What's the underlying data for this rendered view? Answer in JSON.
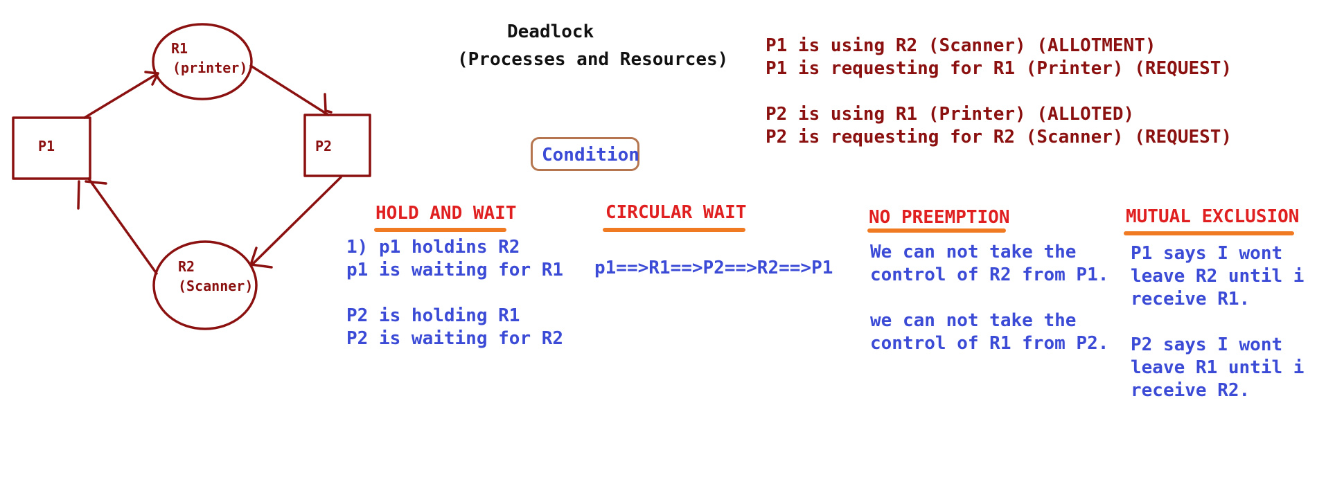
{
  "title": "Deadlock",
  "subtitle": "(Processes and Resources)",
  "allocation_text": "P1 is using R2 (Scanner) (ALLOTMENT)\nP1 is requesting for R1 (Printer) (REQUEST)\n\nP2 is using R1 (Printer) (ALLOTED)\nP2 is requesting for R2 (Scanner) (REQUEST)",
  "condition_label": "Condition",
  "graph": {
    "p1": "P1",
    "p2": "P2",
    "r1_name": "R1",
    "r1_type": "(printer)",
    "r2_name": "R2",
    "r2_type": "(Scanner)"
  },
  "conditions": {
    "hold_and_wait": {
      "heading": "HOLD AND WAIT",
      "text": "1) p1 holdins R2\np1 is waiting for R1\n\nP2 is holding R1\nP2 is waiting for R2"
    },
    "circular_wait": {
      "heading": "CIRCULAR WAIT",
      "text": "p1==>R1==>P2==>R2==>P1"
    },
    "no_preemption": {
      "heading": "NO PREEMPTION",
      "text": "We can not take the\ncontrol of R2 from P1.\n\nwe can not take the\ncontrol of R1 from P2."
    },
    "mutual_exclusion": {
      "heading": "MUTUAL EXCLUSION",
      "text": "P1 says I wont\nleave R2 until i\nreceive R1.\n\nP2 says I wont\nleave R1 until i\nreceive R2."
    }
  },
  "colors": {
    "ink_dark": "#111111",
    "graph_maroon": "#8b1010",
    "body_blue": "#3b4bd6",
    "heading_red": "#e02020",
    "underline_orange": "#f07a22",
    "condition_box_border": "#b5764f"
  }
}
